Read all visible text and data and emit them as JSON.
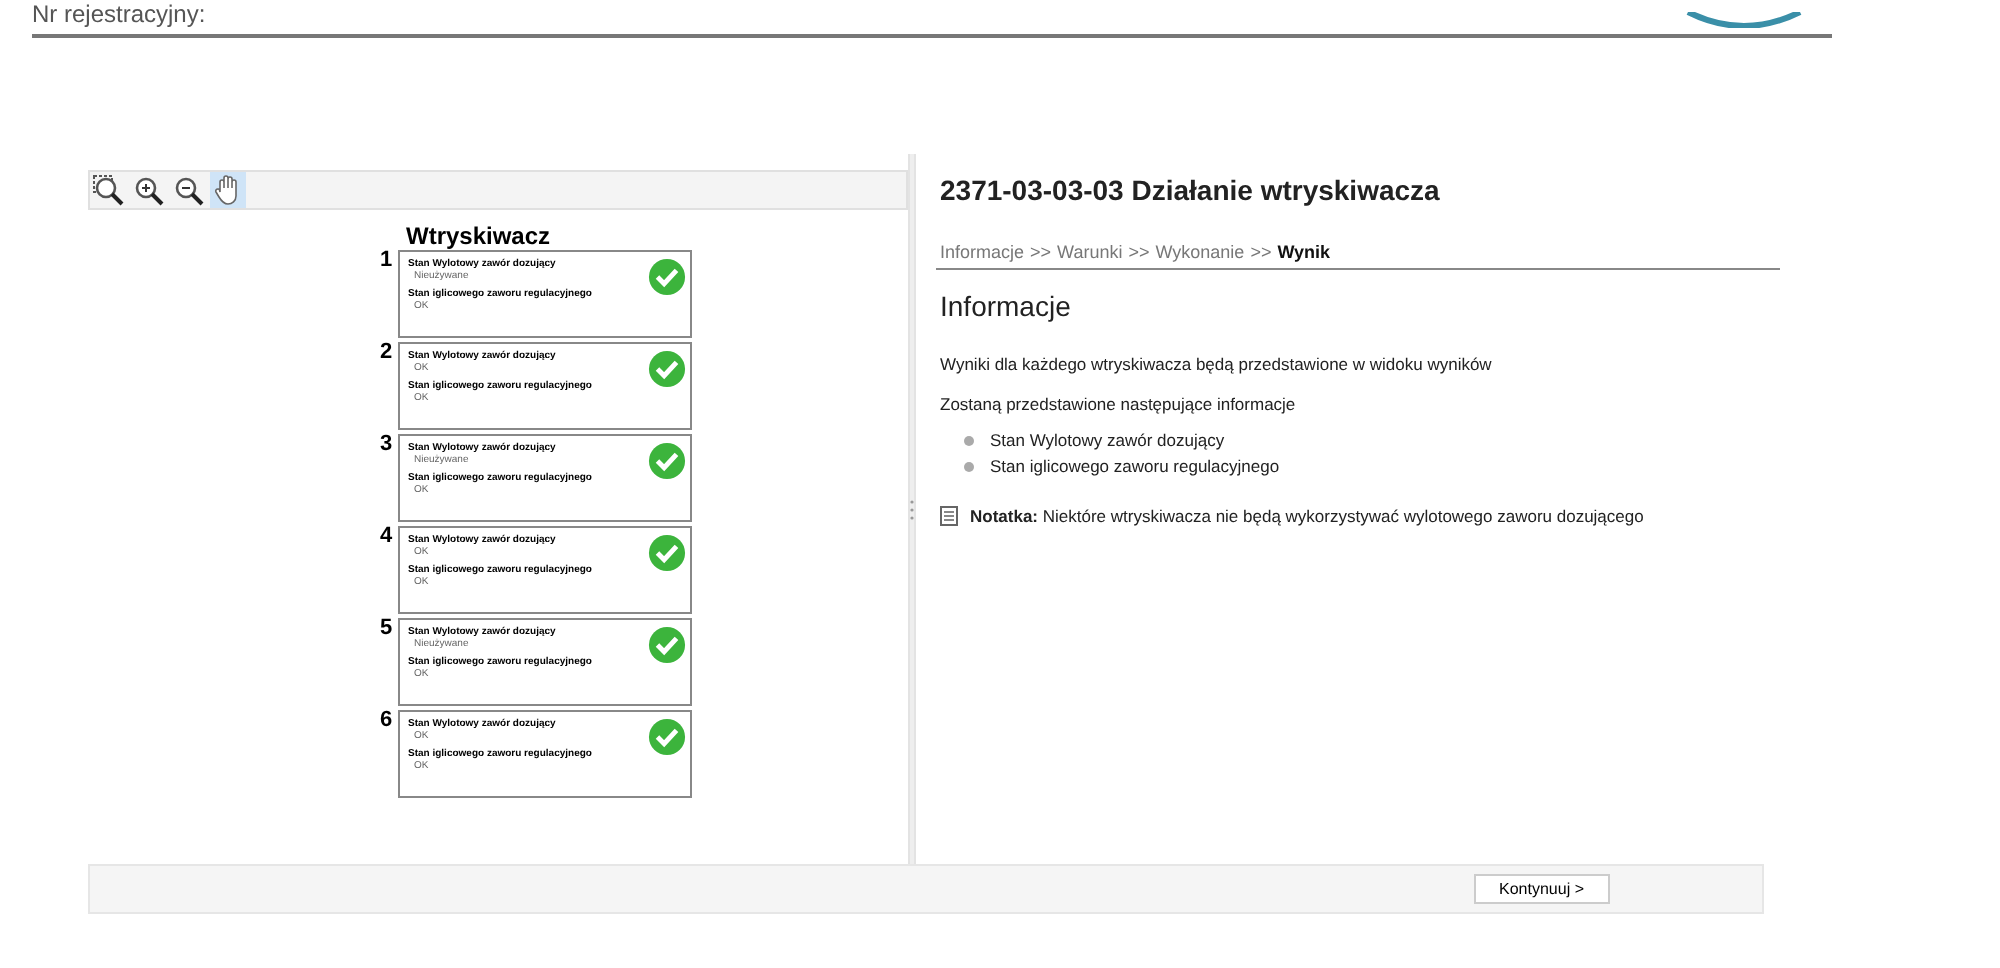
{
  "header": {
    "label": "Nr rejestracyjny:"
  },
  "viewer": {
    "tools": [
      {
        "kind": "zoom-area",
        "selected": false
      },
      {
        "kind": "zoom-in",
        "selected": false
      },
      {
        "kind": "zoom-out",
        "selected": false
      },
      {
        "kind": "pan",
        "selected": true
      }
    ],
    "title": "Wtryskiwacz",
    "injectors": [
      {
        "number": "1",
        "ok": true,
        "rows": [
          {
            "label": "Stan Wylotowy zawór dozujący",
            "value": "Nieużywane"
          },
          {
            "label": "Stan iglicowego zaworu regulacyjnego",
            "value": "OK"
          }
        ]
      },
      {
        "number": "2",
        "ok": true,
        "rows": [
          {
            "label": "Stan Wylotowy zawór dozujący",
            "value": "OK"
          },
          {
            "label": "Stan iglicowego zaworu regulacyjnego",
            "value": "OK"
          }
        ]
      },
      {
        "number": "3",
        "ok": true,
        "rows": [
          {
            "label": "Stan Wylotowy zawór dozujący",
            "value": "Nieużywane"
          },
          {
            "label": "Stan iglicowego zaworu regulacyjnego",
            "value": "OK"
          }
        ]
      },
      {
        "number": "4",
        "ok": true,
        "rows": [
          {
            "label": "Stan Wylotowy zawór dozujący",
            "value": "OK"
          },
          {
            "label": "Stan iglicowego zaworu regulacyjnego",
            "value": "OK"
          }
        ]
      },
      {
        "number": "5",
        "ok": true,
        "rows": [
          {
            "label": "Stan Wylotowy zawór dozujący",
            "value": "Nieużywane"
          },
          {
            "label": "Stan iglicowego zaworu regulacyjnego",
            "value": "OK"
          }
        ]
      },
      {
        "number": "6",
        "ok": true,
        "rows": [
          {
            "label": "Stan Wylotowy zawór dozujący",
            "value": "OK"
          },
          {
            "label": "Stan iglicowego zaworu regulacyjnego",
            "value": "OK"
          }
        ]
      }
    ]
  },
  "info": {
    "title": "2371-03-03-03 Działanie wtryskiwacza",
    "steps": [
      {
        "label": "Informacje",
        "selected": false
      },
      {
        "label": "Warunki",
        "selected": false
      },
      {
        "label": "Wykonanie",
        "selected": false
      },
      {
        "label": "Wynik",
        "selected": true
      }
    ],
    "separator": ">>",
    "heading": "Informacje",
    "paragraphs": [
      "Wyniki dla każdego wtryskiwacza będą przedstawione w widoku wyników",
      "Zostaną przedstawione następujące informacje"
    ],
    "bullets": [
      "Stan Wylotowy zawór dozujący",
      "Stan iglicowego zaworu regulacyjnego"
    ],
    "note": "**Notatka:** Niektóre wtryskiwacza nie będą wykorzystywać wylotowego zaworu dozującego"
  },
  "footer": {
    "button": "Kontynuuj >"
  }
}
